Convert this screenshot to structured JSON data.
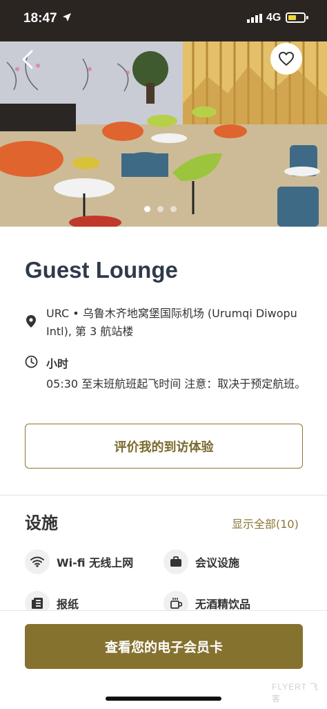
{
  "status": {
    "time": "18:47",
    "network": "4G"
  },
  "carousel": {
    "count": 3,
    "active": 0
  },
  "lounge": {
    "title": "Guest Lounge",
    "address": "URC • 乌鲁木齐地窝堡国际机场 (Urumqi Diwopu Intl), 第 3 航站楼",
    "hours_title": "小时",
    "hours_text": "05:30 至末班航班起飞时间 注意：取决于预定航班。"
  },
  "actions": {
    "review_label": "评价我的到访体验",
    "card_label": "查看您的电子会员卡"
  },
  "facilities": {
    "title": "设施",
    "show_all": "显示全部(10)",
    "items": [
      {
        "label": "Wi-fi 无线上网",
        "icon": "wifi-icon"
      },
      {
        "label": "会议设施",
        "icon": "briefcase-icon"
      },
      {
        "label": "报纸",
        "icon": "newspaper-icon"
      },
      {
        "label": "无酒精饮品",
        "icon": "cup-icon"
      }
    ]
  },
  "watermark": "FLYERT 飞客",
  "colors": {
    "accent": "#85722f",
    "accent_text": "#8a7535",
    "title": "#2f3a4a"
  }
}
